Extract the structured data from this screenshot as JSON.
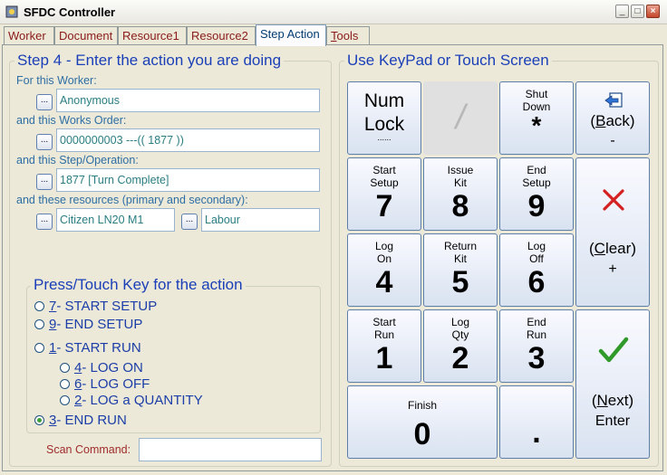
{
  "window": {
    "title": "SFDC Controller",
    "min": "_",
    "max": "□",
    "close": "×"
  },
  "tabs": [
    {
      "label": "Worker"
    },
    {
      "label": "Document"
    },
    {
      "label": "Resource1"
    },
    {
      "label": "Resource2"
    },
    {
      "label": "Step Action"
    },
    {
      "label_u": "T",
      "label_rest": "ools"
    }
  ],
  "step": {
    "heading": "Step 4 - Enter the action you are doing",
    "worker_label": "For this Worker:",
    "worker_value": "Anonymous",
    "order_label": "and this Works Order:",
    "order_value": "0000000003    ---(( 1877 ))",
    "operation_label": "and this Step/Operation:",
    "operation_value": "1877 [Turn Complete]",
    "resources_label": "and these resources (primary and secondary):",
    "resource_primary": "Citizen LN20 M1",
    "resource_secondary": "Labour",
    "dots": "..."
  },
  "press": {
    "heading": "Press/Touch Key for the action",
    "options": [
      {
        "key": "7",
        "text": " - START SETUP",
        "selected": false
      },
      {
        "key": "9",
        "text": " - END SETUP",
        "selected": false
      },
      {
        "key": "1",
        "text": " - START RUN",
        "selected": false
      },
      {
        "key": "4",
        "text": " - LOG ON",
        "selected": false
      },
      {
        "key": "6",
        "text": " - LOG OFF",
        "selected": false
      },
      {
        "key": "2",
        "text": " - LOG a QUANTITY",
        "selected": false
      },
      {
        "key": "3",
        "text": " - END RUN",
        "selected": true
      }
    ],
    "scan_label": "Scan Command:",
    "scan_value": ""
  },
  "keypad": {
    "heading": "Use KeyPad or Touch Screen",
    "numlock": {
      "line1": "Num",
      "line2": "Lock",
      "dots": "......"
    },
    "slash": "/",
    "shutdown": {
      "line1": "Shut",
      "line2": "Down",
      "sym": "*"
    },
    "back": {
      "u": "B",
      "rest": "ack",
      "open": "(",
      "close": ")",
      "sym": "-"
    },
    "k7": {
      "line1": "Start",
      "line2": "Setup",
      "digit": "7"
    },
    "k8": {
      "line1": "Issue",
      "line2": "Kit",
      "digit": "8"
    },
    "k9": {
      "line1": "End",
      "line2": "Setup",
      "digit": "9"
    },
    "clear": {
      "u": "C",
      "rest": "lear",
      "open": "(",
      "close": ")",
      "sym": "+"
    },
    "k4": {
      "line1": "Log",
      "line2": "On",
      "digit": "4"
    },
    "k5": {
      "line1": "Return",
      "line2": "Kit",
      "digit": "5"
    },
    "k6": {
      "line1": "Log",
      "line2": "Off",
      "digit": "6"
    },
    "k1": {
      "line1": "Start",
      "line2": "Run",
      "digit": "1"
    },
    "k2": {
      "line1": "Log",
      "line2": "Qty",
      "digit": "2"
    },
    "k3": {
      "line1": "End",
      "line2": "Run",
      "digit": "3"
    },
    "next": {
      "u": "N",
      "rest": "ext",
      "open": "(",
      "close": ")",
      "sym": "Enter"
    },
    "k0": {
      "line1": "Finish",
      "digit": "0"
    },
    "dot": "."
  },
  "colors": {
    "heading": "#1a3fb8",
    "label": "#2d6ea5",
    "field_text": "#2a7e82",
    "clear_x": "#d42020",
    "check": "#2f9a2a"
  }
}
